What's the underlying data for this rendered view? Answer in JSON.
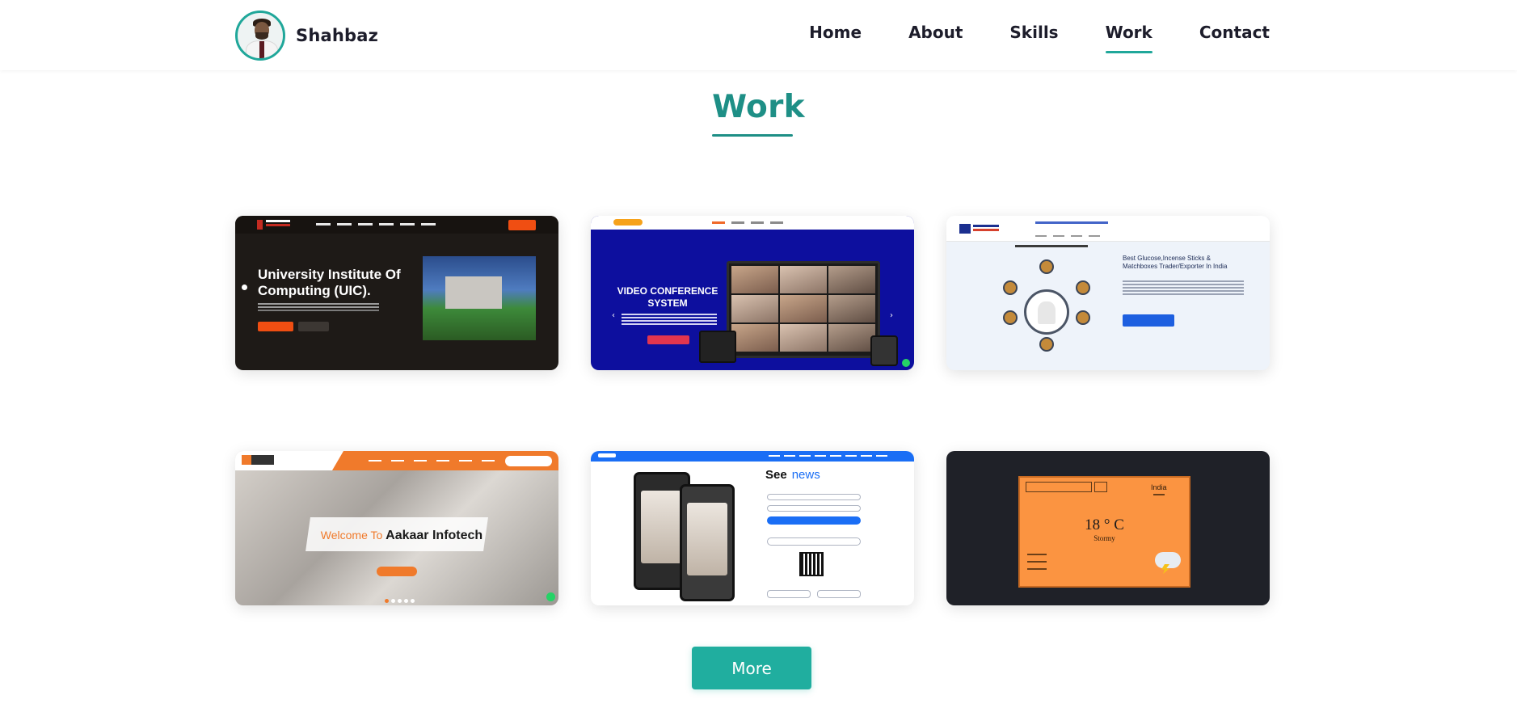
{
  "brand": {
    "name": "Shahbaz"
  },
  "nav": {
    "items": [
      {
        "label": "Home"
      },
      {
        "label": "About"
      },
      {
        "label": "Skills"
      },
      {
        "label": "Work",
        "active": true
      },
      {
        "label": "Contact"
      }
    ]
  },
  "section": {
    "title": "Work"
  },
  "projects": [
    {
      "headline": "University Institute Of Computing (UIC)."
    },
    {
      "headline": "VIDEO CONFERENCE SYSTEM"
    },
    {
      "headline": "Best Glucose,Incense Sticks & Matchboxes Trader/Exporter In India"
    },
    {
      "welcome": "Welcome To",
      "name": "Aakaar Infotech"
    },
    {
      "see": "See",
      "news": "news"
    },
    {
      "city": "India",
      "temp": "18 ° C",
      "desc": "Stormy"
    }
  ],
  "more_button": {
    "label": "More"
  },
  "colors": {
    "accent": "#20a79a",
    "title": "#1e8f86"
  }
}
